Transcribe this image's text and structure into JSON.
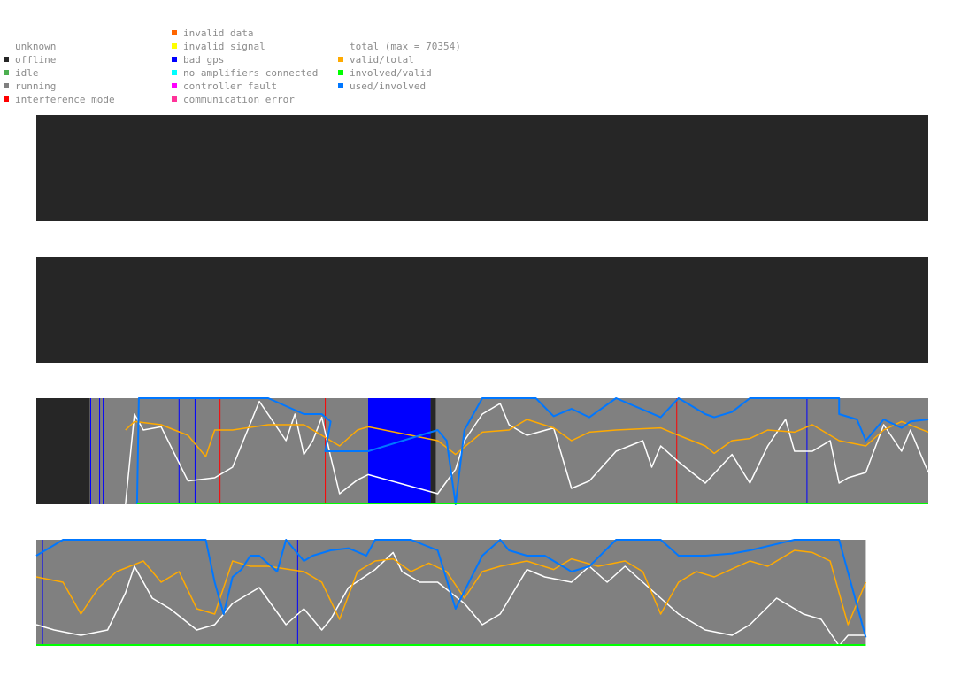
{
  "legend": {
    "status": [
      {
        "label": "unknown",
        "color": "#ffffff"
      },
      {
        "label": "offline",
        "color": "#262626"
      },
      {
        "label": "idle",
        "color": "#4caf50"
      },
      {
        "label": "running",
        "color": "#808080"
      },
      {
        "label": "interference mode",
        "color": "#ff0000"
      }
    ],
    "errors": [
      {
        "label": "invalid data",
        "color": "#ff6600"
      },
      {
        "label": "invalid signal",
        "color": "#ffff00"
      },
      {
        "label": "bad gps",
        "color": "#0000ff"
      },
      {
        "label": "no amplifiers connected",
        "color": "#00ffff"
      },
      {
        "label": "controller fault",
        "color": "#ff00ff"
      },
      {
        "label": "communication error",
        "color": "#ff3399"
      }
    ],
    "metrics": [
      {
        "label": "total (max = 70354)",
        "color": "#ffffff"
      },
      {
        "label": "valid/total",
        "color": "#ffaa00"
      },
      {
        "label": "involved/valid",
        "color": "#00ff00"
      },
      {
        "label": "used/involved",
        "color": "#0077ff"
      }
    ]
  },
  "chart_data": {
    "type": "line",
    "ylim": [
      0,
      1
    ],
    "colors": {
      "offline": "#262626",
      "running": "#808080",
      "bad_gps": "#0000ff",
      "interference": "#ff0000",
      "total": "#ffffff",
      "valid_total": "#ffaa00",
      "involved_valid": "#00ff00",
      "used_involved": "#0077ff"
    },
    "rows": [
      {
        "extent": 1.0,
        "status": [
          {
            "state": "offline",
            "from": 0,
            "to": 1
          }
        ],
        "series": []
      },
      {
        "extent": 1.0,
        "status": [
          {
            "state": "offline",
            "from": 0,
            "to": 1
          }
        ],
        "series": []
      },
      {
        "extent": 1.0,
        "status": [
          {
            "state": "offline",
            "from": 0,
            "to": 0.06
          },
          {
            "state": "running",
            "from": 0.06,
            "to": 0.372
          },
          {
            "state": "bad_gps",
            "from": 0.372,
            "to": 0.442
          },
          {
            "state": "offline",
            "from": 0.442,
            "to": 0.448
          },
          {
            "state": "running",
            "from": 0.448,
            "to": 1
          }
        ],
        "markers": [
          {
            "state": "bad_gps",
            "at": 0.061
          },
          {
            "state": "bad_gps",
            "at": 0.071
          },
          {
            "state": "bad_gps",
            "at": 0.075
          },
          {
            "state": "bad_gps",
            "at": 0.16
          },
          {
            "state": "bad_gps",
            "at": 0.178
          },
          {
            "state": "interference",
            "at": 0.206
          },
          {
            "state": "interference",
            "at": 0.324
          },
          {
            "state": "interference",
            "at": 0.718
          },
          {
            "state": "bad_gps",
            "at": 0.864
          }
        ],
        "series": [
          {
            "key": "total",
            "x": [
              0.1,
              0.11,
              0.12,
              0.14,
              0.17,
              0.2,
              0.22,
              0.25,
              0.28,
              0.29,
              0.3,
              0.31,
              0.32,
              0.33,
              0.34,
              0.36,
              0.372,
              0.45,
              0.47,
              0.48,
              0.5,
              0.52,
              0.53,
              0.55,
              0.58,
              0.6,
              0.62,
              0.65,
              0.68,
              0.69,
              0.7,
              0.72,
              0.75,
              0.78,
              0.8,
              0.82,
              0.84,
              0.85,
              0.87,
              0.89,
              0.9,
              0.91,
              0.93,
              0.95,
              0.97,
              0.98,
              1.0
            ],
            "values": [
              0.0,
              0.85,
              0.7,
              0.73,
              0.22,
              0.25,
              0.35,
              0.97,
              0.6,
              0.85,
              0.47,
              0.6,
              0.82,
              0.45,
              0.1,
              0.23,
              0.28,
              0.1,
              0.33,
              0.6,
              0.85,
              0.95,
              0.75,
              0.65,
              0.72,
              0.15,
              0.22,
              0.5,
              0.6,
              0.35,
              0.55,
              0.4,
              0.2,
              0.47,
              0.2,
              0.55,
              0.8,
              0.5,
              0.5,
              0.6,
              0.2,
              0.25,
              0.3,
              0.75,
              0.5,
              0.7,
              0.3
            ]
          },
          {
            "key": "valid_total",
            "x": [
              0.1,
              0.11,
              0.14,
              0.17,
              0.19,
              0.2,
              0.22,
              0.26,
              0.3,
              0.32,
              0.34,
              0.36,
              0.372,
              0.45,
              0.47,
              0.5,
              0.53,
              0.55,
              0.58,
              0.6,
              0.62,
              0.65,
              0.7,
              0.72,
              0.75,
              0.76,
              0.78,
              0.8,
              0.82,
              0.85,
              0.87,
              0.9,
              0.93,
              0.95,
              0.97,
              1.0
            ],
            "values": [
              0.7,
              0.78,
              0.75,
              0.65,
              0.45,
              0.7,
              0.7,
              0.75,
              0.75,
              0.65,
              0.55,
              0.7,
              0.73,
              0.6,
              0.47,
              0.68,
              0.7,
              0.8,
              0.72,
              0.6,
              0.68,
              0.7,
              0.72,
              0.65,
              0.55,
              0.48,
              0.6,
              0.62,
              0.7,
              0.68,
              0.75,
              0.6,
              0.55,
              0.7,
              0.78,
              0.68
            ]
          },
          {
            "key": "used_involved",
            "x": [
              0.113,
              0.115,
              0.16,
              0.2,
              0.22,
              0.24,
              0.26,
              0.3,
              0.32,
              0.33,
              0.324,
              0.36,
              0.372,
              0.45,
              0.46,
              0.47,
              0.48,
              0.5,
              0.54,
              0.55,
              0.56,
              0.58,
              0.6,
              0.62,
              0.65,
              0.7,
              0.72,
              0.75,
              0.76,
              0.78,
              0.8,
              0.82,
              0.85,
              0.87,
              0.89,
              0.9,
              0.9,
              0.92,
              0.93,
              0.95,
              0.97,
              0.98,
              1.0
            ],
            "values": [
              0.0,
              1.0,
              1.0,
              1.0,
              1.0,
              1.0,
              1.0,
              0.85,
              0.85,
              0.78,
              0.5,
              0.5,
              0.5,
              0.7,
              0.6,
              0.0,
              0.7,
              1.0,
              1.0,
              1.0,
              1.0,
              0.83,
              0.9,
              0.82,
              1.0,
              0.82,
              1.0,
              0.85,
              0.82,
              0.87,
              1.0,
              1.0,
              1.0,
              1.0,
              1.0,
              1.0,
              0.85,
              0.8,
              0.6,
              0.8,
              0.72,
              0.78,
              0.8
            ]
          }
        ],
        "baseline": {
          "key": "involved_valid",
          "value": 0.0,
          "from": 0.113,
          "to": 1.0
        }
      },
      {
        "extent": 0.93,
        "status": [
          {
            "state": "running",
            "from": 0,
            "to": 0.93
          }
        ],
        "markers": [
          {
            "state": "bad_gps",
            "at": 0.007
          },
          {
            "state": "bad_gps",
            "at": 0.293
          }
        ],
        "series": [
          {
            "key": "total",
            "x": [
              0.0,
              0.02,
              0.05,
              0.08,
              0.1,
              0.11,
              0.12,
              0.13,
              0.15,
              0.18,
              0.2,
              0.22,
              0.25,
              0.28,
              0.3,
              0.32,
              0.33,
              0.35,
              0.38,
              0.4,
              0.41,
              0.43,
              0.45,
              0.48,
              0.5,
              0.52,
              0.55,
              0.57,
              0.6,
              0.62,
              0.64,
              0.66,
              0.68,
              0.7,
              0.72,
              0.75,
              0.78,
              0.8,
              0.83,
              0.86,
              0.88,
              0.9,
              0.91,
              0.93
            ],
            "values": [
              0.2,
              0.15,
              0.1,
              0.15,
              0.5,
              0.75,
              0.6,
              0.45,
              0.35,
              0.15,
              0.2,
              0.4,
              0.55,
              0.2,
              0.35,
              0.15,
              0.25,
              0.55,
              0.72,
              0.88,
              0.7,
              0.6,
              0.6,
              0.4,
              0.2,
              0.3,
              0.72,
              0.65,
              0.6,
              0.75,
              0.6,
              0.75,
              0.6,
              0.45,
              0.3,
              0.15,
              0.1,
              0.2,
              0.45,
              0.3,
              0.25,
              0.0,
              0.1,
              0.1
            ]
          },
          {
            "key": "valid_total",
            "x": [
              0.0,
              0.03,
              0.05,
              0.07,
              0.09,
              0.12,
              0.14,
              0.16,
              0.18,
              0.2,
              0.22,
              0.24,
              0.26,
              0.3,
              0.32,
              0.34,
              0.36,
              0.38,
              0.4,
              0.42,
              0.44,
              0.46,
              0.48,
              0.5,
              0.52,
              0.55,
              0.58,
              0.6,
              0.63,
              0.66,
              0.68,
              0.7,
              0.72,
              0.74,
              0.76,
              0.8,
              0.82,
              0.85,
              0.87,
              0.89,
              0.9,
              0.91,
              0.93
            ],
            "values": [
              0.65,
              0.6,
              0.3,
              0.55,
              0.7,
              0.8,
              0.6,
              0.7,
              0.35,
              0.3,
              0.8,
              0.75,
              0.75,
              0.7,
              0.6,
              0.25,
              0.7,
              0.8,
              0.82,
              0.7,
              0.78,
              0.7,
              0.45,
              0.7,
              0.75,
              0.8,
              0.72,
              0.82,
              0.75,
              0.8,
              0.7,
              0.3,
              0.6,
              0.7,
              0.65,
              0.8,
              0.75,
              0.9,
              0.88,
              0.8,
              0.5,
              0.2,
              0.6
            ]
          },
          {
            "key": "used_involved",
            "x": [
              0.0,
              0.02,
              0.03,
              0.05,
              0.07,
              0.1,
              0.12,
              0.15,
              0.19,
              0.2,
              0.21,
              0.22,
              0.23,
              0.24,
              0.25,
              0.27,
              0.28,
              0.3,
              0.31,
              0.33,
              0.35,
              0.37,
              0.38,
              0.39,
              0.4,
              0.42,
              0.45,
              0.47,
              0.5,
              0.52,
              0.53,
              0.55,
              0.57,
              0.6,
              0.62,
              0.65,
              0.67,
              0.7,
              0.72,
              0.75,
              0.78,
              0.8,
              0.85,
              0.9,
              0.93
            ],
            "values": [
              0.85,
              0.95,
              1.0,
              1.0,
              1.0,
              1.0,
              1.0,
              1.0,
              1.0,
              0.6,
              0.3,
              0.65,
              0.72,
              0.85,
              0.85,
              0.7,
              1.0,
              0.8,
              0.85,
              0.9,
              0.92,
              0.85,
              1.0,
              1.0,
              1.0,
              1.0,
              0.9,
              0.35,
              0.85,
              1.0,
              0.9,
              0.85,
              0.85,
              0.7,
              0.75,
              1.0,
              1.0,
              1.0,
              0.85,
              0.85,
              0.87,
              0.9,
              1.0,
              1.0,
              0.08
            ]
          }
        ],
        "baseline": {
          "key": "involved_valid",
          "value": 0.0,
          "from": 0.0,
          "to": 0.93
        }
      }
    ]
  }
}
